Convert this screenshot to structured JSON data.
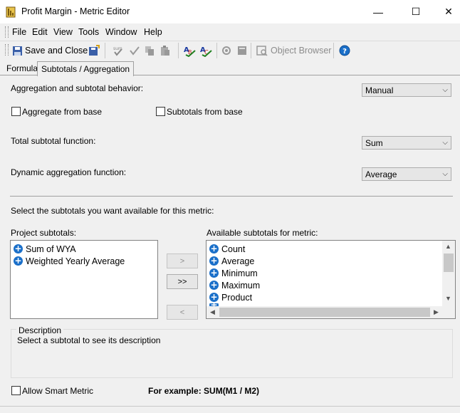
{
  "window": {
    "title": "Profit Margin - Metric Editor",
    "controls": {
      "minimize": "—",
      "maximize": "☐",
      "close": "✕"
    }
  },
  "menu": [
    "File",
    "Edit",
    "View",
    "Tools",
    "Window",
    "Help"
  ],
  "toolbar": {
    "save_close_label": "Save and Close",
    "object_browser_label": "Object Browser"
  },
  "tabs": [
    {
      "label": "Formula",
      "active": false
    },
    {
      "label": "Subtotals / Aggregation",
      "active": true
    }
  ],
  "form": {
    "aggregation_label": "Aggregation and subtotal behavior:",
    "aggregation_value": "Manual",
    "aggregate_from_base_label": "Aggregate from base",
    "aggregate_from_base_checked": false,
    "subtotals_from_base_label": "Subtotals from base",
    "subtotals_from_base_checked": false,
    "total_subtotal_label": "Total subtotal function:",
    "total_subtotal_value": "Sum",
    "dynamic_aggregation_label": "Dynamic aggregation function:",
    "dynamic_aggregation_value": "Average",
    "select_subtotals_text": "Select the subtotals you want available for this metric:"
  },
  "project_subtotals": {
    "label": "Project subtotals:",
    "items": [
      "Sum of WYA",
      "Weighted Yearly Average"
    ]
  },
  "available_subtotals": {
    "label": "Available subtotals for metric:",
    "items": [
      "Count",
      "Average",
      "Minimum",
      "Maximum",
      "Product"
    ]
  },
  "move_buttons": {
    "add": ">",
    "add_all": ">>",
    "remove": "<"
  },
  "description": {
    "legend": "Description",
    "text": "Select a subtotal to see its description"
  },
  "footer": {
    "smart_metric_label": "Allow Smart Metric",
    "smart_metric_checked": false,
    "example_text": "For example: SUM(M1 / M2)"
  },
  "colors": {
    "accent": "#1a6fc9",
    "background": "#f0f0f0"
  }
}
